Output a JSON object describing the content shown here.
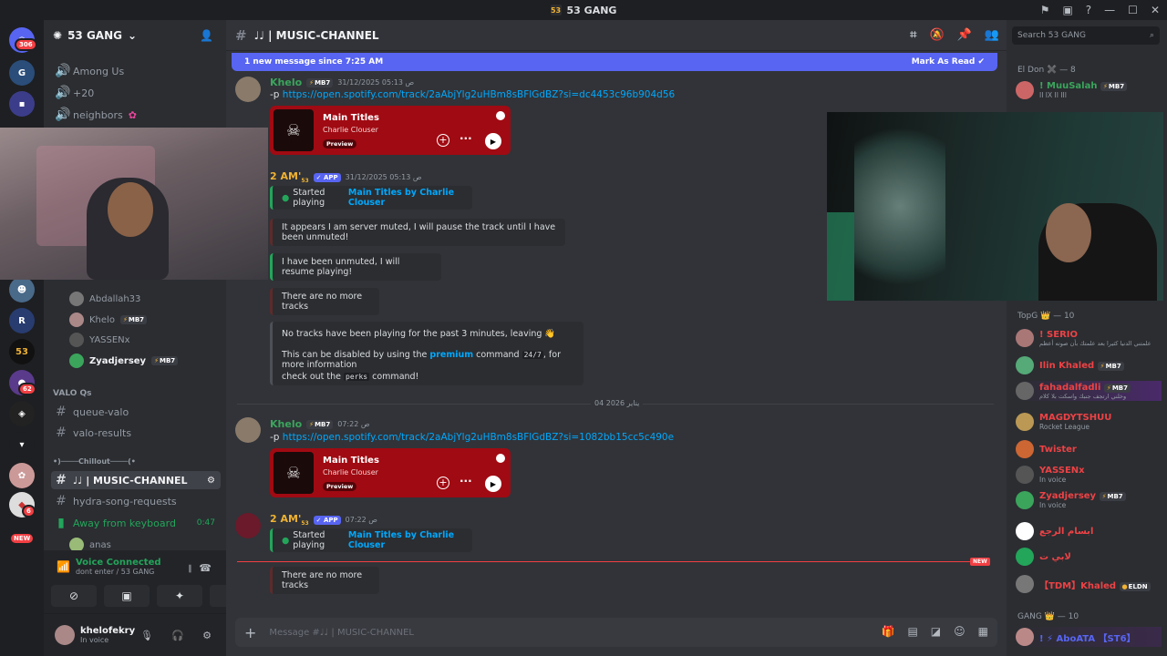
{
  "titlebar": {
    "title": "53 GANG",
    "server_icon": "53"
  },
  "servers": {
    "badge_top": "306",
    "badge_mid": "62",
    "badge_low": "6",
    "new_label": "NEW",
    "active_label": "53"
  },
  "sidebar": {
    "server_name": "53 GANG",
    "top_channels": [
      {
        "label": "Among Us"
      },
      {
        "label": "+20"
      },
      {
        "label": "neighbors"
      }
    ],
    "voice_users": [
      {
        "name": "Abdallah33"
      },
      {
        "name": "Khelo",
        "tag": "MB7"
      },
      {
        "name": "YASSENx"
      },
      {
        "name": "Zyadjersey",
        "tag": "MB7"
      }
    ],
    "category_valo": "VALO Qs",
    "valo_channels": [
      {
        "label": "queue-valo"
      },
      {
        "label": "valo-results"
      }
    ],
    "category_chillout": "•)────Chillout────(•",
    "active_channel": "♩♩ | MUSIC-CHANNEL",
    "chill_channels": [
      {
        "label": "hydra-song-requests"
      }
    ],
    "voice_channel": {
      "label": "Away from keyboard",
      "time": "0:47"
    },
    "voice_channel_user": "anas",
    "voice_panel": {
      "status": "Voice Connected",
      "sub": "dont enter / 53 GANG"
    },
    "user": {
      "name": "khelofekry",
      "status": "In voice"
    }
  },
  "channel": {
    "name": "♩♩ | MUSIC-CHANNEL",
    "new_bar": {
      "text": "1 new message since 7:25 AM",
      "action": "Mark As Read"
    },
    "messages": [
      {
        "author": "Khelo",
        "tag": "MB7",
        "time": "31/12/2025 05:13 ص",
        "prefix": "-p ",
        "link": "https://open.spotify.com/track/2aAbjYlg2uHBm8sBFlGdBZ?si=dc4453c96b904d56",
        "embed": {
          "title": "Main Titles",
          "artist": "Charlie Clouser",
          "preview": "Preview"
        }
      },
      {
        "author": "2 AM'",
        "author_sub": "53",
        "app": "✓ APP",
        "time": "31/12/2025 05:13 ص",
        "e1_pre": "Started playing ",
        "e1_hl": "Main Titles by Charlie Clouser",
        "e2": "It appears I am server muted, I will pause the track until I have been unmuted!",
        "e3": "I have been unmuted, I will resume playing!",
        "e4": "There are no more tracks",
        "e5_a": "No tracks have been playing for the past 3 minutes, leaving 👋",
        "e5_b1": "This can be disabled by using the ",
        "e5_b_hl": "premium",
        "e5_b2": " command ",
        "e5_code1": "24/7",
        "e5_b3": ", for more information",
        "e5_c1": "check out the ",
        "e5_code2": "perks",
        "e5_c2": " command!"
      },
      {
        "author": "Khelo",
        "tag": "MB7",
        "time": "07:22 ص",
        "prefix": "-p ",
        "link": "https://open.spotify.com/track/2aAbjYlg2uHBm8sBFlGdBZ?si=1082bb15cc5c490e",
        "embed": {
          "title": "Main Titles",
          "artist": "Charlie Clouser",
          "preview": "Preview"
        }
      },
      {
        "author": "2 AM'",
        "author_sub": "53",
        "app": "✓ APP",
        "time": "07:22 ص",
        "e1_pre": "Started playing ",
        "e1_hl": "Main Titles by Charlie Clouser",
        "e4": "There are no more tracks"
      }
    ],
    "date_divider": "04 يناير 2026",
    "new_tag": "NEW",
    "composer_placeholder": "Message #♩♩ | MUSIC-CHANNEL"
  },
  "members": {
    "search_placeholder": "Search 53 GANG",
    "role1": "El Don ✖️ — 8",
    "role1_members": [
      {
        "name": "! MuuSalah",
        "sub": "II IX II III",
        "tag": "MB7",
        "color": "#3ba55c"
      }
    ],
    "role2": "TopG 👑 — 10",
    "role2_members": [
      {
        "name": "! SERIO",
        "sub": "علمتني الدنيا كثيرا بعد علمتك بأن صوته أعظم",
        "color": "#ed4245"
      },
      {
        "name": "Ilin Khaled",
        "tag": "MB7",
        "color": "#ed4245"
      },
      {
        "name": "fahadalfadli",
        "tag": "MB7",
        "sub": "وخلني ارتجف جنبك واسكت بلا كلام",
        "color": "#ed4245"
      },
      {
        "name": "MAGDYTSHUU",
        "sub": "Rocket League",
        "color": "#ed4245"
      },
      {
        "name": "Twister",
        "color": "#ed4245"
      },
      {
        "name": "YASSENx",
        "sub": "In voice",
        "color": "#ed4245"
      },
      {
        "name": "Zyadjersey",
        "tag": "MB7",
        "sub": "In voice",
        "color": "#ed4245"
      },
      {
        "name": "ابسام الرجع",
        "color": "#ed4245"
      },
      {
        "name": "لابي ت",
        "color": "#ed4245"
      },
      {
        "name": "【TDM】Khaled",
        "tag": "ELDN",
        "color": "#ed4245"
      }
    ],
    "role3": "GANG 👑 — 10",
    "role3_members": [
      {
        "name": "! ⚡ AboATA 【ST6】",
        "color": "#5865f2"
      }
    ]
  },
  "colors": {
    "accent": "#5865f2",
    "online": "#23a55a",
    "danger": "#f23f43",
    "link": "#00a8fc",
    "spotify": "#a00a12"
  }
}
